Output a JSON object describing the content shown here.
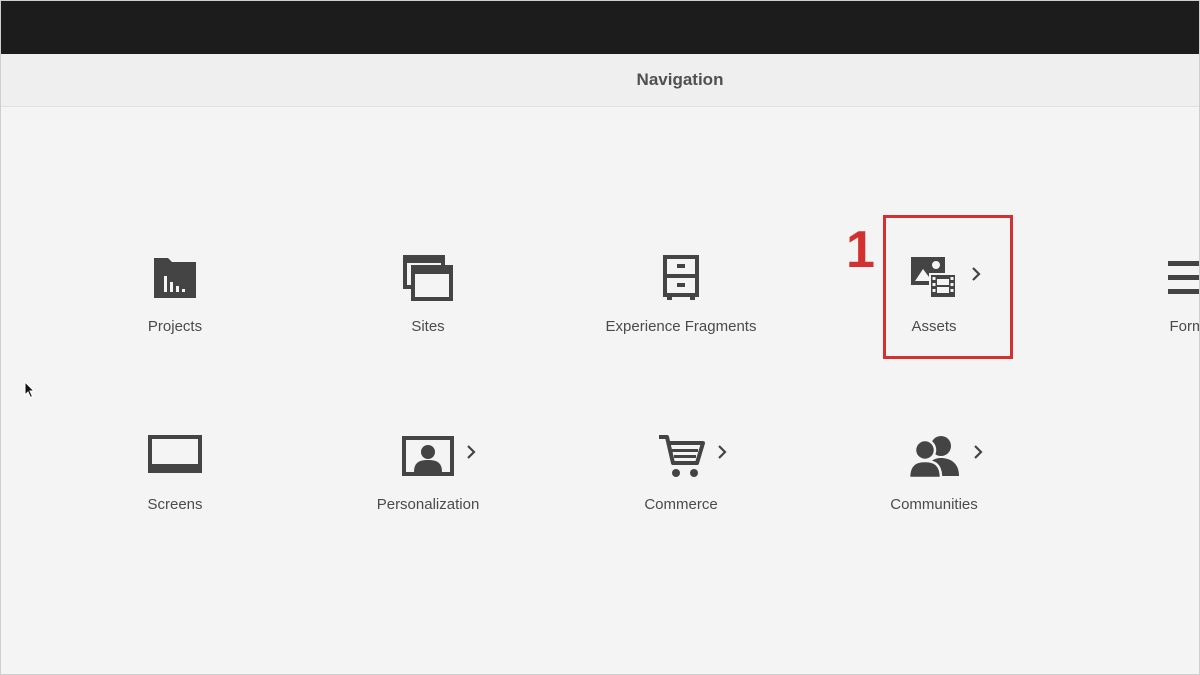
{
  "header": {
    "title": "Navigation"
  },
  "tiles": [
    {
      "label": "Projects"
    },
    {
      "label": "Sites"
    },
    {
      "label": "Experience Fragments"
    },
    {
      "label": "Assets"
    },
    {
      "label": "Form"
    },
    {
      "label": "Screens"
    },
    {
      "label": "Personalization"
    },
    {
      "label": "Commerce"
    },
    {
      "label": "Communities"
    }
  ],
  "annotation": {
    "marker": "1"
  },
  "colors": {
    "icon": "#444444",
    "highlight": "#d3312f",
    "topbar": "#1c1c1c",
    "background": "#f4f4f4"
  }
}
